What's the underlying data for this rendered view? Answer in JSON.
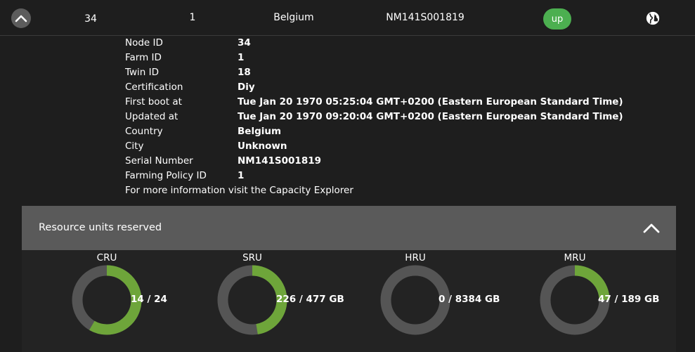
{
  "node_row": {
    "node_id": "34",
    "farm_id": "1",
    "country": "Belgium",
    "serial": "NM141S001819",
    "status": "up",
    "colors": {
      "status": "#4caf50",
      "background": "#1e1e1e"
    },
    "icons": {
      "toggle": "chevron-up-icon",
      "globe": "globe-icon"
    }
  },
  "details": [
    {
      "label": "Node ID",
      "value": "34"
    },
    {
      "label": "Farm ID",
      "value": "1"
    },
    {
      "label": "Twin ID",
      "value": "18"
    },
    {
      "label": "Certification",
      "value": "Diy"
    },
    {
      "label": "First boot at",
      "value": "Tue Jan 20 1970 05:25:04 GMT+0200 (Eastern European Standard Time)"
    },
    {
      "label": "Updated at",
      "value": "Tue Jan 20 1970 09:20:04 GMT+0200 (Eastern European Standard Time)"
    },
    {
      "label": "Country",
      "value": "Belgium"
    },
    {
      "label": "City",
      "value": "Unknown"
    },
    {
      "label": "Serial Number",
      "value": "NM141S001819"
    },
    {
      "label": "Farming Policy ID",
      "value": "1"
    }
  ],
  "more_info": {
    "prefix": "For more information visit the ",
    "link_text": "Capacity Explorer"
  },
  "resources": {
    "title": "Resource units reserved",
    "icons": {
      "toggle": "chevron-up-icon"
    },
    "colors": {
      "used": "#6ea53a",
      "track": "#555555",
      "header": "#5a5a5a"
    },
    "units": [
      {
        "name": "CRU",
        "text": "14 / 24",
        "used": 14,
        "total": 24
      },
      {
        "name": "SRU",
        "text": "226 / 477 GB",
        "used": 226,
        "total": 477
      },
      {
        "name": "HRU",
        "text": "0 / 8384 GB",
        "used": 0,
        "total": 8384
      },
      {
        "name": "MRU",
        "text": "47 / 189 GB",
        "used": 47,
        "total": 189
      }
    ]
  }
}
